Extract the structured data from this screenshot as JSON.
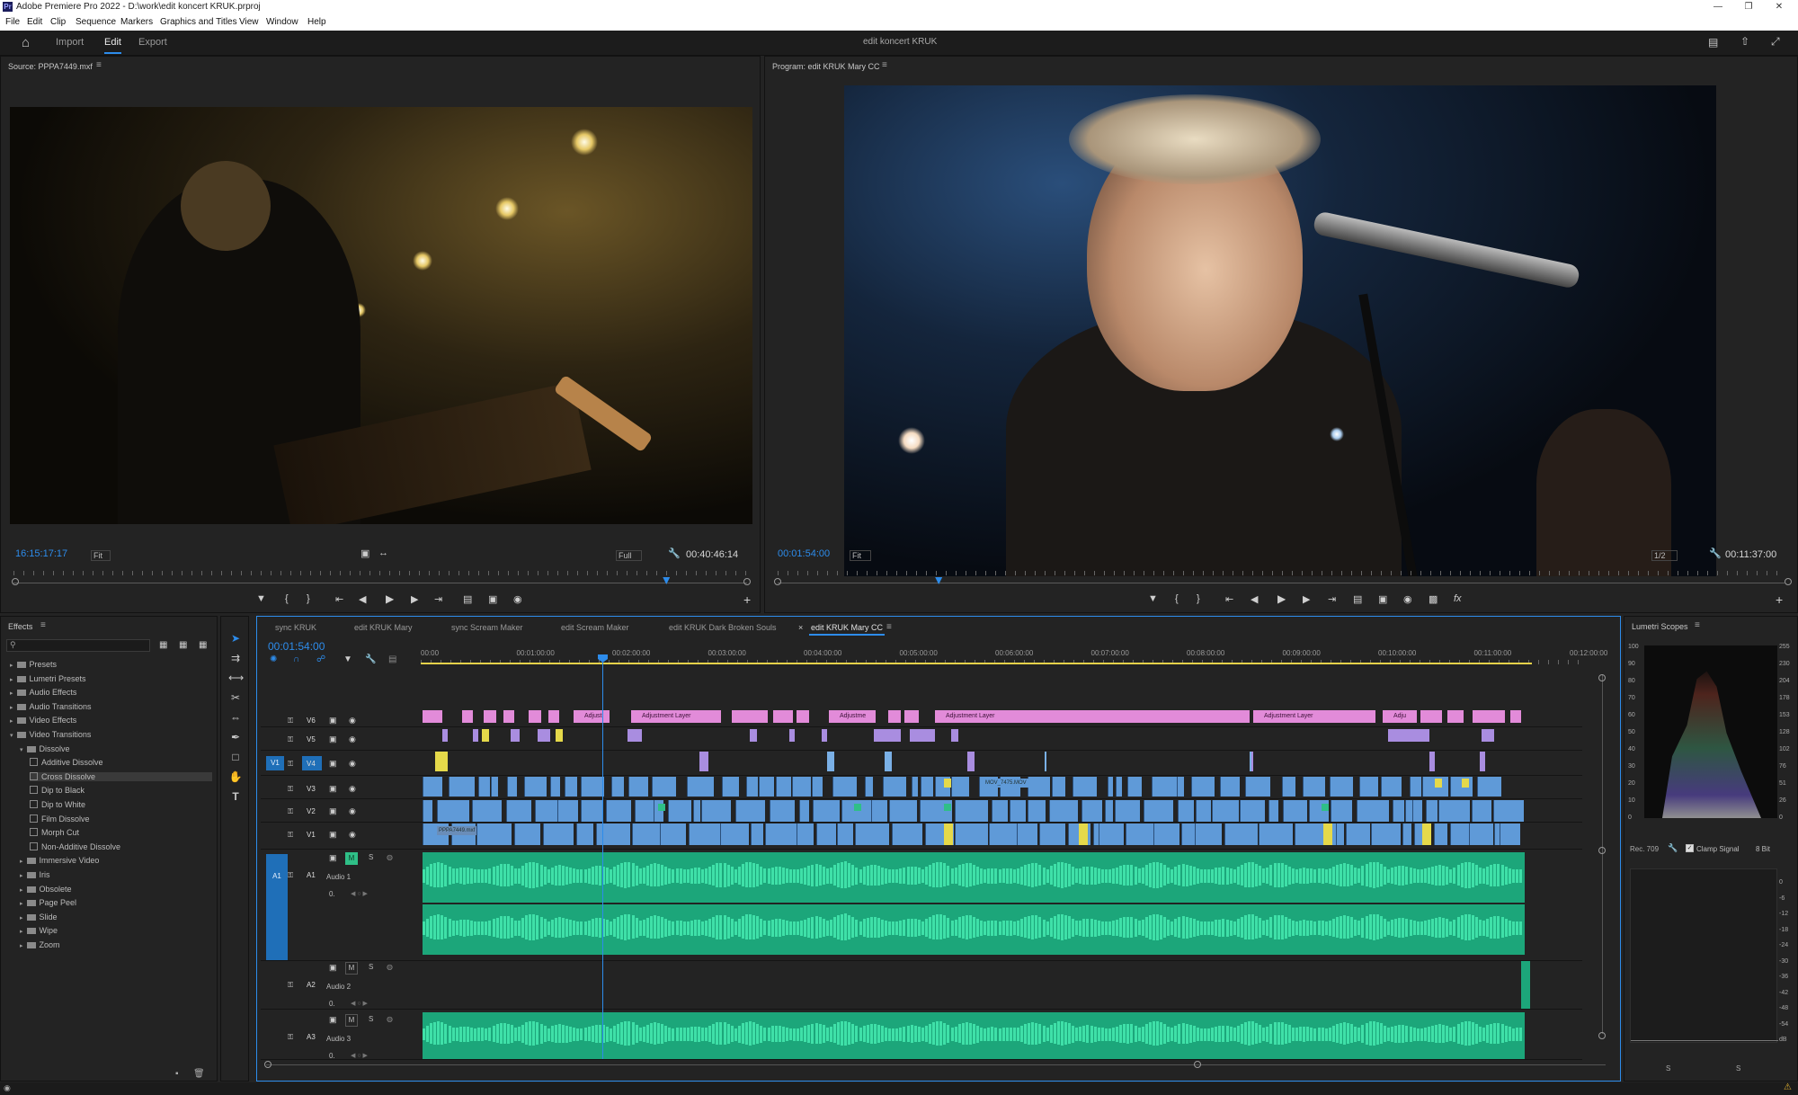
{
  "window": {
    "title": "Adobe Premiere Pro 2022 - D:\\work\\edit koncert KRUK.prproj",
    "app_icon": "Pr"
  },
  "menu": [
    "File",
    "Edit",
    "Clip",
    "Sequence",
    "Markers",
    "Graphics and Titles",
    "View",
    "Window",
    "Help"
  ],
  "workspace": {
    "tabs": [
      "Import",
      "Edit",
      "Export"
    ],
    "active": "Edit",
    "project_name": "edit koncert KRUK"
  },
  "source_monitor": {
    "title": "Source: PPPA7449.mxf",
    "timecode": "16:15:17:17",
    "zoom": "Fit",
    "resolution": "Full",
    "duration": "00:40:46:14",
    "playhead_fraction": 0.89,
    "image": "guitarist-on-stage-back-view"
  },
  "program_monitor": {
    "title": "Program: edit KRUK Mary CC",
    "timecode": "00:01:54:00",
    "zoom": "Fit",
    "resolution": "1/2",
    "duration": "00:11:37:00",
    "playhead_fraction": 0.16,
    "image": "singer-at-microphone"
  },
  "effects_panel": {
    "title": "Effects",
    "search_placeholder": "",
    "tree": [
      {
        "label": "Presets",
        "type": "folder",
        "level": 0
      },
      {
        "label": "Lumetri Presets",
        "type": "folder",
        "level": 0
      },
      {
        "label": "Audio Effects",
        "type": "folder",
        "level": 0
      },
      {
        "label": "Audio Transitions",
        "type": "folder",
        "level": 0
      },
      {
        "label": "Video Effects",
        "type": "folder",
        "level": 0
      },
      {
        "label": "Video Transitions",
        "type": "folder",
        "level": 0,
        "expanded": true
      },
      {
        "label": "Dissolve",
        "type": "folder",
        "level": 1,
        "expanded": true
      },
      {
        "label": "Additive Dissolve",
        "type": "effect",
        "level": 2
      },
      {
        "label": "Cross Dissolve",
        "type": "effect",
        "level": 2,
        "selected": true
      },
      {
        "label": "Dip to Black",
        "type": "effect",
        "level": 2
      },
      {
        "label": "Dip to White",
        "type": "effect",
        "level": 2
      },
      {
        "label": "Film Dissolve",
        "type": "effect",
        "level": 2
      },
      {
        "label": "Morph Cut",
        "type": "effect",
        "level": 2
      },
      {
        "label": "Non-Additive Dissolve",
        "type": "effect",
        "level": 2
      },
      {
        "label": "Immersive Video",
        "type": "folder",
        "level": 1
      },
      {
        "label": "Iris",
        "type": "folder",
        "level": 1
      },
      {
        "label": "Obsolete",
        "type": "folder",
        "level": 1
      },
      {
        "label": "Page Peel",
        "type": "folder",
        "level": 1
      },
      {
        "label": "Slide",
        "type": "folder",
        "level": 1
      },
      {
        "label": "Wipe",
        "type": "folder",
        "level": 1
      },
      {
        "label": "Zoom",
        "type": "folder",
        "level": 1
      }
    ]
  },
  "timeline": {
    "tabs": [
      "sync KRUK",
      "edit KRUK Mary",
      "sync Scream Maker",
      "edit Scream Maker",
      "edit KRUK Dark Broken Souls",
      "edit KRUK Mary CC"
    ],
    "active_tab": "edit KRUK Mary CC",
    "timecode": "00:01:54:00",
    "ruler": [
      "00:00",
      "00:01:00:00",
      "00:02:00:00",
      "00:03:00:00",
      "00:04:00:00",
      "00:05:00:00",
      "00:06:00:00",
      "00:07:00:00",
      "00:08:00:00",
      "00:09:00:00",
      "00:10:00:00",
      "00:11:00:00",
      "00:12:00:00"
    ],
    "video_tracks": [
      "V6",
      "V5",
      "V4",
      "V3",
      "V2",
      "V1"
    ],
    "source_patch_video": "V1",
    "source_patch_audio": "A1",
    "audio_tracks": [
      {
        "id": "A1",
        "name": "Audio 1",
        "level": "0."
      },
      {
        "id": "A2",
        "name": "Audio 2",
        "level": "0."
      },
      {
        "id": "A3",
        "name": "Audio 3",
        "level": "0."
      }
    ],
    "clip_labels": {
      "adjustment": "Adjustment Layer",
      "adjust_short": "Adjust",
      "adjustme": "Adjustme",
      "adju": "Adju",
      "v3_clip": "MOV_7475.MOV",
      "v1_clip": "PPPA7449.mxf"
    }
  },
  "lumetri": {
    "title": "Lumetri Scopes",
    "left_scale": [
      "100",
      "90",
      "80",
      "70",
      "60",
      "50",
      "40",
      "30",
      "20",
      "10",
      "0"
    ],
    "right_scale": [
      "255",
      "230",
      "204",
      "178",
      "153",
      "128",
      "102",
      "76",
      "51",
      "26",
      "0"
    ],
    "meter_scale": [
      "0",
      "-6",
      "-12",
      "-18",
      "-24",
      "-30",
      "-36",
      "-42",
      "-48",
      "-54",
      "dB"
    ],
    "color_space": "Rec. 709",
    "clamp_signal": "Clamp Signal",
    "bit_depth": "8 Bit",
    "meter_buttons": [
      "S",
      "S"
    ]
  },
  "colors": {
    "accent": "#2d8ceb",
    "adjustment": "#e28bd9",
    "video": "#5f9ad8",
    "audio": "#1ca67a",
    "nested": "#a98de0"
  }
}
